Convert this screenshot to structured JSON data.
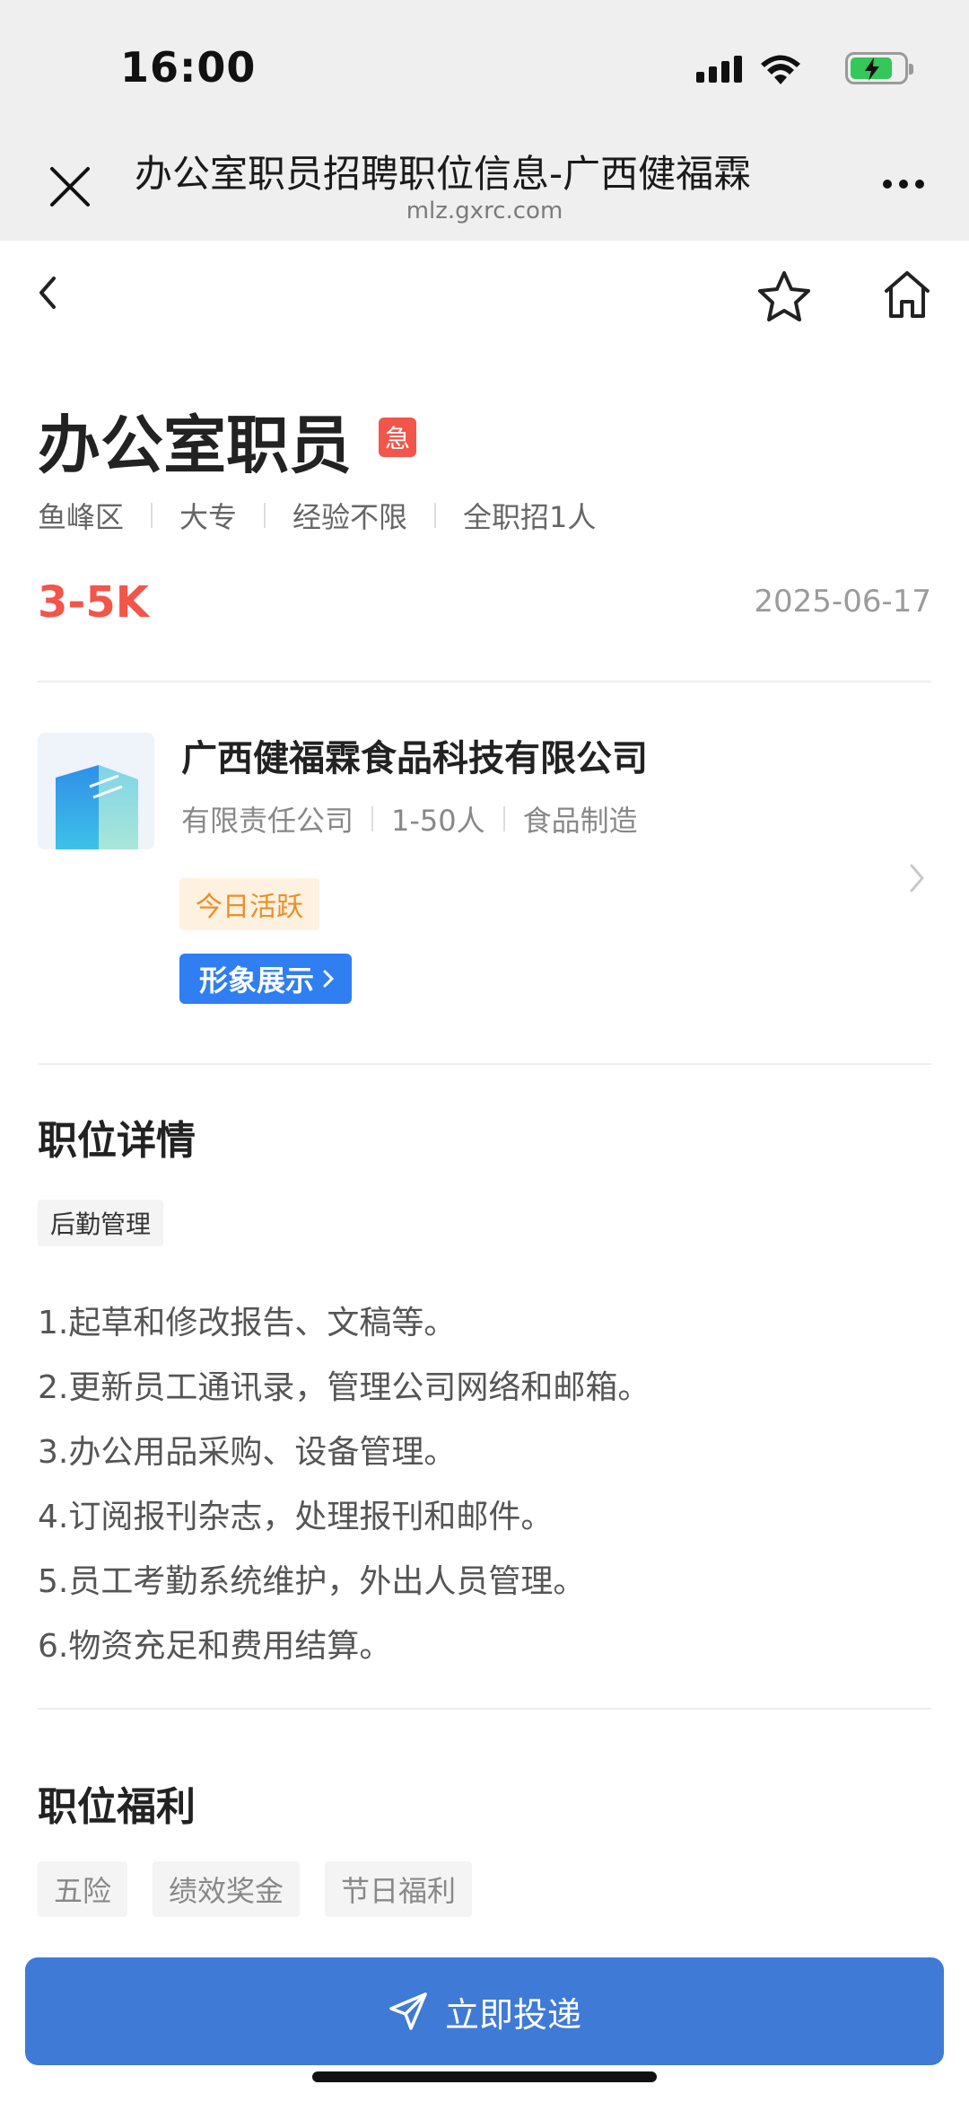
{
  "status_bar": {
    "time": "16:00"
  },
  "browser": {
    "title": "办公室职员招聘职位信息-广西健福霖",
    "domain": "mlz.gxrc.com"
  },
  "job": {
    "title": "办公室职员",
    "urgent_badge": "急",
    "meta": [
      "鱼峰区",
      "大专",
      "经验不限",
      "全职招1人"
    ],
    "salary": "3-5K",
    "date": "2025-06-17"
  },
  "company": {
    "name": "广西健福霖食品科技有限公司",
    "meta": [
      "有限责任公司",
      "1-50人",
      "食品制造"
    ],
    "active_tag": "今日活跃",
    "showcase_label": "形象展示"
  },
  "details": {
    "title": "职位详情",
    "category": "后勤管理",
    "lines": [
      "1.起草和修改报告、文稿等。",
      "2.更新员工通讯录，管理公司网络和邮箱。",
      "3.办公用品采购、设备管理。",
      "4.订阅报刊杂志，处理报刊和邮件。",
      "5.员工考勤系统维护，外出人员管理。",
      "6.物资充足和费用结算。"
    ]
  },
  "benefits": {
    "title": "职位福利",
    "items": [
      "五险",
      "绩效奖金",
      "节日福利"
    ]
  },
  "apply_button": {
    "label": "立即投递"
  },
  "colors": {
    "accent_red": "#f2554a",
    "primary_blue": "#3f7ad6",
    "showcase_blue": "#2f7ef2",
    "active_orange": "#e98f2a"
  }
}
